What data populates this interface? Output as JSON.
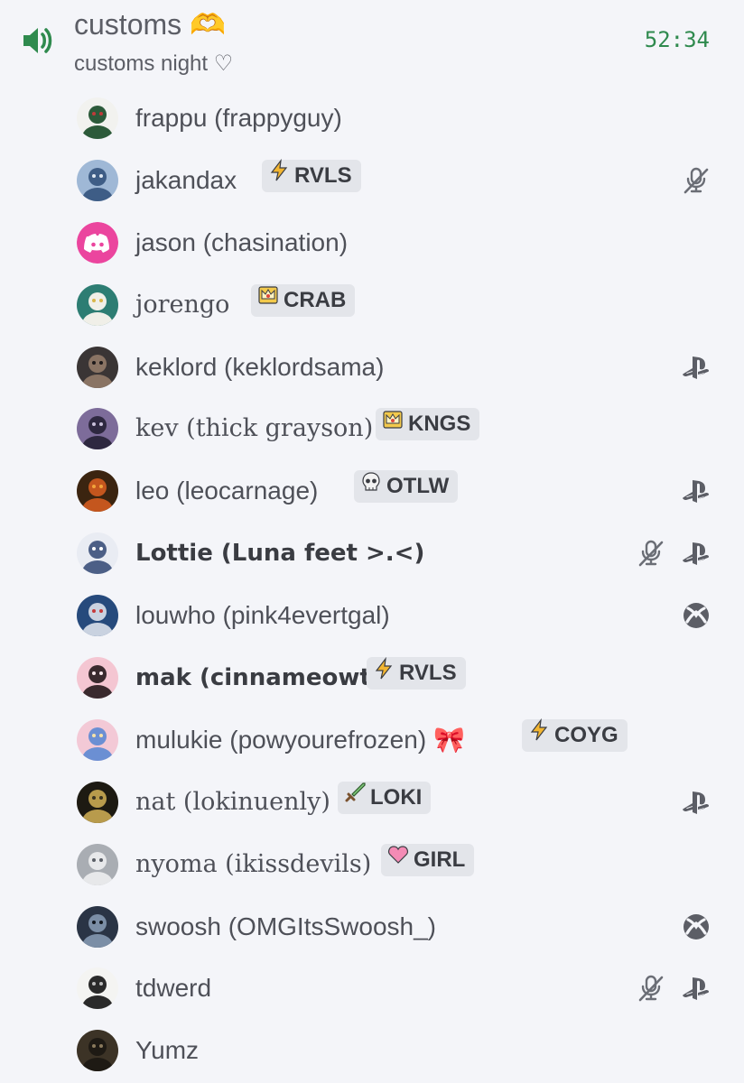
{
  "channel": {
    "name": "customs",
    "name_emoji": "🫶",
    "status": "customs night ♡",
    "timer": "52:34"
  },
  "colors": {
    "background": "#f4f5f9",
    "timer": "#2f8a4e",
    "tag_bg": "#e3e5ea",
    "icon": "#5c5e66"
  },
  "members": [
    {
      "name": "frappu (frappyguy)",
      "style": "normal",
      "avatar": "avatar-cartoon",
      "tag": null,
      "icons": []
    },
    {
      "name": "jakandax",
      "style": "normal",
      "avatar": "avatar-blue-art",
      "tag": {
        "icon": "lightning-icon",
        "label": "RVLS"
      },
      "icons": [
        "muted-mic-icon"
      ]
    },
    {
      "name": "jason (chasination)",
      "style": "normal",
      "avatar": "avatar-discord-default",
      "tag": null,
      "icons": []
    },
    {
      "name": "jorengo",
      "style": "serif",
      "avatar": "avatar-teal-cat",
      "tag": {
        "icon": "crown-icon",
        "label": "CRAB"
      },
      "icons": []
    },
    {
      "name": "keklord (keklordsama)",
      "style": "normal",
      "avatar": "avatar-photo",
      "tag": null,
      "icons": [
        "playstation-icon"
      ]
    },
    {
      "name": "kev (thick grayson)",
      "style": "serif",
      "avatar": "avatar-purple-art",
      "tag": {
        "icon": "crown-icon",
        "label": "KNGS"
      },
      "icons": []
    },
    {
      "name": "leo (leocarnage)",
      "style": "normal",
      "avatar": "avatar-fire",
      "tag": {
        "icon": "skull-icon",
        "label": "OTLW"
      },
      "icons": [
        "playstation-icon"
      ]
    },
    {
      "name": "Lottie (Luna feet >.<)",
      "style": "bold",
      "avatar": "avatar-shark",
      "tag": null,
      "icons": [
        "muted-mic-icon",
        "playstation-icon"
      ]
    },
    {
      "name": "louwho (pink4evertgal)",
      "style": "normal",
      "avatar": "avatar-captain",
      "tag": null,
      "icons": [
        "xbox-icon"
      ]
    },
    {
      "name": "mak (cinnameowth)",
      "style": "bold",
      "avatar": "avatar-pink-anime",
      "tag": {
        "icon": "lightning-icon",
        "label": "RVLS"
      },
      "icons": []
    },
    {
      "name": "mulukie (powyourefrozen)",
      "style": "normal",
      "avatar": "avatar-sailor",
      "name_emoji": "🎀",
      "tag": {
        "icon": "lightning-icon",
        "label": "COYG"
      },
      "icons": []
    },
    {
      "name": "nat (lokinuenly)",
      "style": "serif",
      "avatar": "avatar-loki",
      "tag": {
        "icon": "sword-icon",
        "label": "LOKI"
      },
      "icons": [
        "playstation-icon"
      ]
    },
    {
      "name": "nyoma (ikissdevils)",
      "style": "serif",
      "avatar": "avatar-white-hair",
      "tag": {
        "icon": "heart-icon",
        "label": "GIRL"
      },
      "icons": []
    },
    {
      "name": "swoosh (OMGItsSwoosh_)",
      "style": "normal",
      "avatar": "avatar-dark-art",
      "tag": null,
      "icons": [
        "xbox-icon"
      ]
    },
    {
      "name": "tdwerd",
      "style": "normal",
      "avatar": "avatar-sketch",
      "tag": null,
      "icons": [
        "muted-mic-icon",
        "playstation-icon"
      ]
    },
    {
      "name": "Yumz",
      "style": "normal",
      "avatar": "avatar-dark-photo",
      "tag": null,
      "icons": []
    }
  ]
}
